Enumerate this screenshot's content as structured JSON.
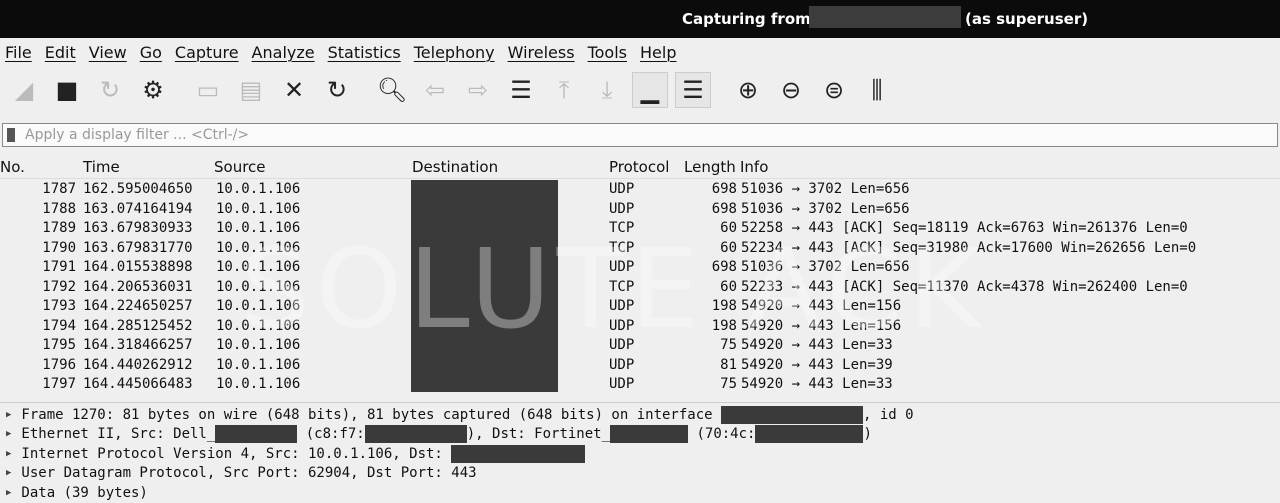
{
  "title": {
    "prefix": "Capturing from",
    "suffix": "(as superuser)"
  },
  "menu": [
    "File",
    "Edit",
    "View",
    "Go",
    "Capture",
    "Analyze",
    "Statistics",
    "Telephony",
    "Wireless",
    "Tools",
    "Help"
  ],
  "toolbar": [
    "start-capture",
    "stop-capture",
    "restart-capture",
    "capture-options",
    "open-file",
    "save-file",
    "close-file",
    "reload-file",
    "find-packet",
    "go-back",
    "go-forward",
    "go-to-packet",
    "go-first",
    "go-last",
    "autoscroll",
    "colorize",
    "zoom-in",
    "zoom-out",
    "zoom-normal",
    "resize-columns"
  ],
  "filter": {
    "placeholder": "Apply a display filter ... <Ctrl-/>"
  },
  "columns": [
    "No.",
    "Time",
    "Source",
    "Destination",
    "Protocol",
    "Length",
    "Info"
  ],
  "rows": [
    {
      "no": "1787",
      "time": "162.595004650",
      "src": "10.0.1.106",
      "proto": "UDP",
      "len": "698",
      "info": "51036 → 3702 Len=656"
    },
    {
      "no": "1788",
      "time": "163.074164194",
      "src": "10.0.1.106",
      "proto": "UDP",
      "len": "698",
      "info": "51036 → 3702 Len=656"
    },
    {
      "no": "1789",
      "time": "163.679830933",
      "src": "10.0.1.106",
      "proto": "TCP",
      "len": "60",
      "info": "52258 → 443 [ACK] Seq=18119 Ack=6763 Win=261376 Len=0"
    },
    {
      "no": "1790",
      "time": "163.679831770",
      "src": "10.0.1.106",
      "proto": "TCP",
      "len": "60",
      "info": "52234 → 443 [ACK] Seq=31980 Ack=17600 Win=262656 Len=0"
    },
    {
      "no": "1791",
      "time": "164.015538898",
      "src": "10.0.1.106",
      "proto": "UDP",
      "len": "698",
      "info": "51036 → 3702 Len=656"
    },
    {
      "no": "1792",
      "time": "164.206536031",
      "src": "10.0.1.106",
      "proto": "TCP",
      "len": "60",
      "info": "52233 → 443 [ACK] Seq=11370 Ack=4378 Win=262400 Len=0"
    },
    {
      "no": "1793",
      "time": "164.224650257",
      "src": "10.0.1.106",
      "proto": "UDP",
      "len": "198",
      "info": "54920 → 443 Len=156"
    },
    {
      "no": "1794",
      "time": "164.285125452",
      "src": "10.0.1.106",
      "proto": "UDP",
      "len": "198",
      "info": "54920 → 443 Len=156"
    },
    {
      "no": "1795",
      "time": "164.318466257",
      "src": "10.0.1.106",
      "proto": "UDP",
      "len": "75",
      "info": "54920 → 443 Len=33"
    },
    {
      "no": "1796",
      "time": "164.440262912",
      "src": "10.0.1.106",
      "proto": "UDP",
      "len": "81",
      "info": "54920 → 443 Len=39"
    },
    {
      "no": "1797",
      "time": "164.445066483",
      "src": "10.0.1.106",
      "proto": "UDP",
      "len": "75",
      "info": "54920 → 443 Len=33"
    }
  ],
  "watermark": "SOLUTE ACK",
  "details": {
    "frame": {
      "a": "Frame 1270: 81 bytes on wire (648 bits), 81 bytes captured (648 bits) on interface ",
      "b": ", id 0"
    },
    "eth": {
      "a": "Ethernet II, Src: Dell_",
      "b": " (c8:f7:",
      "c": "), Dst: Fortinet_",
      "d": " (70:4c:",
      "e": ")"
    },
    "ip": {
      "a": "Internet Protocol Version 4, Src: 10.0.1.106, Dst: "
    },
    "udp": "User Datagram Protocol, Src Port: 62904, Dst Port: 443",
    "data": "Data (39 bytes)"
  }
}
